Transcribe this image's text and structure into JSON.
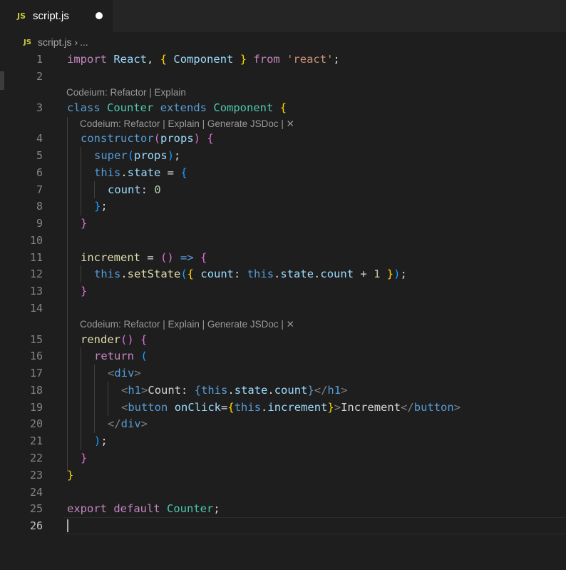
{
  "tab": {
    "icon": "JS",
    "title": "script.js",
    "unsaved_indicator": "dot-icon"
  },
  "breadcrumb": {
    "icon": "JS",
    "file": "script.js",
    "separator": "›",
    "more": "..."
  },
  "codelens": {
    "class_lens": "Codeium: Refactor | Explain",
    "method_lens": "Codeium: Refactor | Explain | Generate JSDoc | ✕"
  },
  "line_numbers": [
    "1",
    "2",
    "3",
    "4",
    "5",
    "6",
    "7",
    "8",
    "9",
    "10",
    "11",
    "12",
    "13",
    "14",
    "15",
    "16",
    "17",
    "18",
    "19",
    "20",
    "21",
    "22",
    "23",
    "24",
    "25",
    "26"
  ],
  "code": {
    "l1": {
      "kw_import": "import",
      "t1": " ",
      "react": "React",
      "t2": ", ",
      "b_open": "{",
      "t3": " ",
      "component": "Component",
      "t4": " ",
      "b_close": "}",
      "t5": " ",
      "kw_from": "from",
      "t6": " ",
      "str": "'react'",
      "t7": ";"
    },
    "l3": {
      "kw_class": "class",
      "t1": " ",
      "name": "Counter",
      "t2": " ",
      "kw_extends": "extends",
      "t3": " ",
      "base": "Component",
      "t4": " ",
      "b": "{"
    },
    "l4": {
      "fn": "constructor",
      "p_open": "(",
      "arg": "props",
      "p_close": ")",
      "t1": " ",
      "b": "{"
    },
    "l5": {
      "kw": "super",
      "p_open": "(",
      "arg": "props",
      "p_close": ")",
      "t1": ";"
    },
    "l6": {
      "kw": "this",
      "t1": ".",
      "prop": "state",
      "t2": " = ",
      "b": "{"
    },
    "l7": {
      "prop": "count",
      "t1": ": ",
      "num": "0"
    },
    "l8": {
      "b": "}",
      "t1": ";"
    },
    "l9": {
      "b": "}"
    },
    "l11": {
      "fn": "increment",
      "t1": " = ",
      "p_open": "(",
      "p_close": ")",
      "t2": " ",
      "arrow": "=>",
      "t3": " ",
      "b": "{"
    },
    "l12": {
      "kw": "this",
      "t1": ".",
      "fn": "setState",
      "p_open": "(",
      "b_open": "{",
      "t2": " ",
      "prop": "count",
      "t3": ": ",
      "kw2": "this",
      "t4": ".",
      "state": "state",
      "t5": ".",
      "count": "count",
      "t6": " + ",
      "num": "1",
      "t7": " ",
      "b_close": "}",
      "p_close": ")",
      "t8": ";"
    },
    "l13": {
      "b": "}"
    },
    "l15": {
      "fn": "render",
      "p_open": "(",
      "p_close": ")",
      "t1": " ",
      "b": "{"
    },
    "l16": {
      "kw": "return",
      "t1": " ",
      "p": "("
    },
    "l17": {
      "lt": "<",
      "tag": "div",
      "gt": ">"
    },
    "l18": {
      "lt": "<",
      "tag": "h1",
      "gt": ">",
      "text": "Count: ",
      "b_open": "{",
      "kw": "this",
      "t1": ".",
      "state": "state",
      "t2": ".",
      "count": "count",
      "b_close": "}",
      "lt2": "</",
      "tag2": "h1",
      "gt2": ">"
    },
    "l19": {
      "lt": "<",
      "tag": "button",
      "t1": " ",
      "attr": "onClick",
      "eq": "=",
      "b_open": "{",
      "kw": "this",
      "t2": ".",
      "fn": "increment",
      "b_close": "}",
      "gt": ">",
      "text": "Increment",
      "lt2": "</",
      "tag2": "button",
      "gt2": ">"
    },
    "l20": {
      "lt": "</",
      "tag": "div",
      "gt": ">"
    },
    "l21": {
      "p": ")",
      "t1": ";"
    },
    "l22": {
      "b": "}"
    },
    "l23": {
      "b": "}"
    },
    "l25": {
      "kw": "export",
      "t1": " ",
      "kw2": "default",
      "t2": " ",
      "name": "Counter",
      "t3": ";"
    }
  }
}
